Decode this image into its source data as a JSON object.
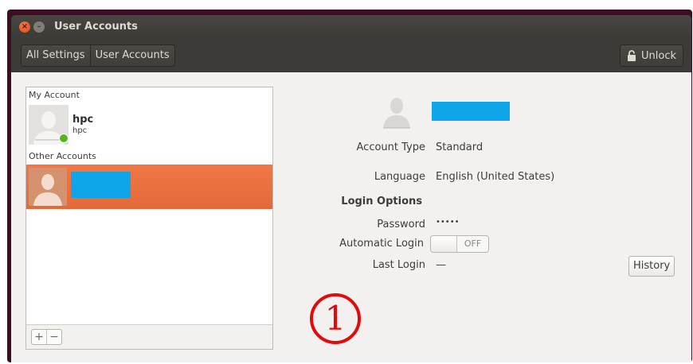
{
  "window": {
    "title": "User Accounts"
  },
  "toolbar": {
    "breadcrumbs": [
      "All Settings",
      "User Accounts"
    ],
    "unlock_label": "Unlock"
  },
  "accounts": {
    "my_account_label": "My Account",
    "current_user": {
      "name": "hpc",
      "username": "hpc",
      "status": "online"
    },
    "other_accounts_label": "Other Accounts",
    "buttons": {
      "add": "+",
      "remove": "−"
    }
  },
  "details": {
    "account_type_label": "Account Type",
    "account_type_value": "Standard",
    "language_label": "Language",
    "language_value": "English (United States)",
    "login_options_label": "Login Options",
    "password_label": "Password",
    "password_value": "•••••",
    "auto_login_label": "Automatic Login",
    "auto_login_state": "OFF",
    "last_login_label": "Last Login",
    "last_login_value": "—",
    "history_button": "History"
  },
  "annotation": {
    "marker": "1"
  },
  "colors": {
    "selected_row": "#e96f3f",
    "redaction": "#0ea5e9",
    "annotation": "#e20b0b",
    "titlebar": "#3c3b37"
  }
}
